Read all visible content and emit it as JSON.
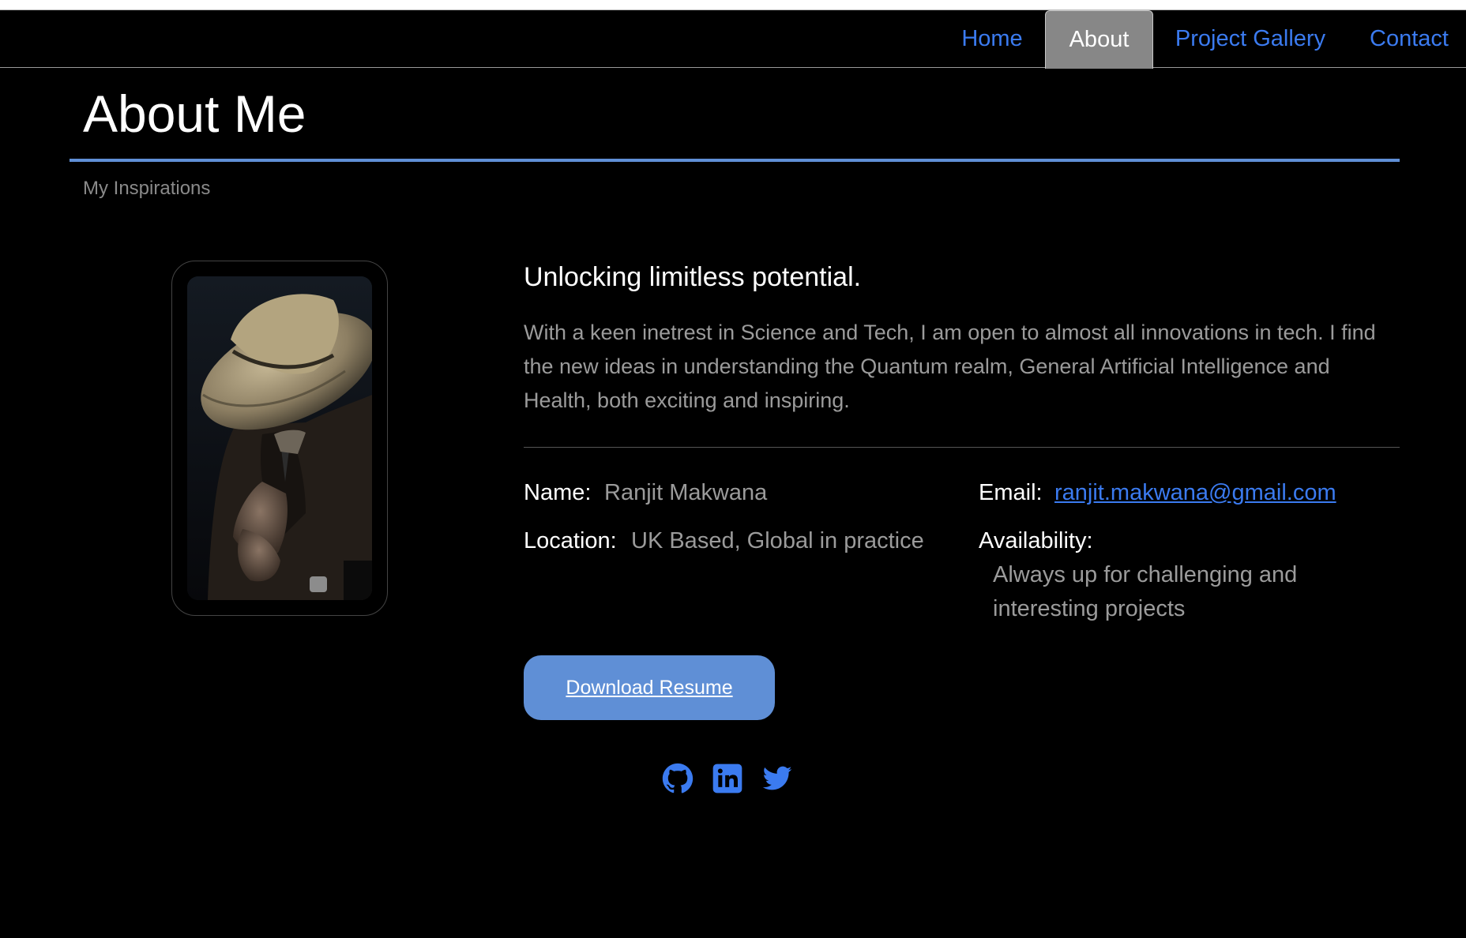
{
  "nav": {
    "items": [
      {
        "label": "Home",
        "active": false
      },
      {
        "label": "About",
        "active": true
      },
      {
        "label": "Project Gallery",
        "active": false
      },
      {
        "label": "Contact",
        "active": false
      }
    ]
  },
  "page": {
    "title": "About Me",
    "subtitle": "My Inspirations"
  },
  "about": {
    "headline": "Unlocking limitless potential.",
    "bio": "With a keen inetrest in Science and Tech, I am open to almost all innovations in tech. I find the new ideas in understanding the Quantum realm, General Artificial Intelligence and Health, both exciting and inspiring."
  },
  "info": {
    "name_label": "Name:",
    "name_value": "Ranjit Makwana",
    "location_label": "Location:",
    "location_value": "UK Based, Global in practice",
    "email_label": "Email:",
    "email_value": "ranjit.makwana@gmail.com",
    "availability_label": "Availability:",
    "availability_value_line1": "Always up for challenging and",
    "availability_value_line2": "interesting projects"
  },
  "actions": {
    "download_label": "Download Resume"
  },
  "social": [
    {
      "icon": "github-icon"
    },
    {
      "icon": "linkedin-icon"
    },
    {
      "icon": "twitter-icon"
    }
  ],
  "colors": {
    "background": "#000000",
    "link": "#3b7bf0",
    "accent": "#5f8fd6",
    "active_tab": "#878787",
    "muted_text": "#9b9b9b"
  }
}
